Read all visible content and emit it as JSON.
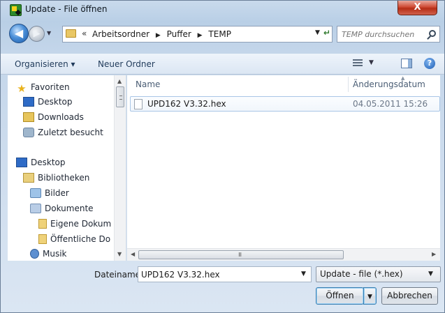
{
  "window": {
    "title": "Update - File öffnen",
    "close_label": "X"
  },
  "nav": {
    "back_glyph": "◀",
    "forward_glyph": "▶",
    "history_glyph": "▼",
    "breadcrumb_prefix": "«",
    "breadcrumbs": [
      "Arbeitsordner",
      "Puffer",
      "TEMP"
    ],
    "crumb_separator": "▶",
    "address_dropdown_glyph": "▼",
    "refresh_glyph": "↵"
  },
  "search": {
    "placeholder": "TEMP durchsuchen"
  },
  "toolbar": {
    "organize_label": "Organisieren ▾",
    "new_folder_label": "Neuer Ordner",
    "views_dropdown_glyph": "▼",
    "help_glyph": "?"
  },
  "sidebar": {
    "items": [
      {
        "label": "Favoriten",
        "icon": "star-icon"
      },
      {
        "label": "Desktop",
        "icon": "desktop-icon"
      },
      {
        "label": "Downloads",
        "icon": "downloads-folder-icon"
      },
      {
        "label": "Zuletzt besucht",
        "icon": "recent-places-icon"
      },
      {
        "label": "Desktop",
        "icon": "desktop-icon"
      },
      {
        "label": "Bibliotheken",
        "icon": "libraries-icon"
      },
      {
        "label": "Bilder",
        "icon": "pictures-icon"
      },
      {
        "label": "Dokumente",
        "icon": "documents-icon"
      },
      {
        "label": "Eigene Dokum",
        "icon": "folder-icon"
      },
      {
        "label": "Öffentliche Do",
        "icon": "folder-icon"
      },
      {
        "label": "Musik",
        "icon": "music-icon"
      }
    ],
    "scroll_up_glyph": "▲",
    "scroll_down_glyph": "▼"
  },
  "filelist": {
    "columns": [
      "Name",
      "Änderungsdatum"
    ],
    "sort_glyph": "▲",
    "rows": [
      {
        "name": "UPD162 V3.32.hex",
        "modified": "04.05.2011 15:26"
      }
    ],
    "hscroll_left_glyph": "◀",
    "hscroll_right_glyph": "▶",
    "hscroll_grip": "III"
  },
  "bottom": {
    "filename_label": "Dateiname:",
    "filename_value": "UPD162 V3.32.hex",
    "filename_dropdown_glyph": "▼",
    "filter_value": "Update - file (*.hex)",
    "filter_dropdown_glyph": "▼",
    "open_label": "Öffnen",
    "open_split_glyph": "▼",
    "cancel_label": "Abbrechen"
  },
  "colors": {
    "accent": "#3c7fb1",
    "close": "#cf4b35",
    "selection_border": "#a9c6e6"
  }
}
